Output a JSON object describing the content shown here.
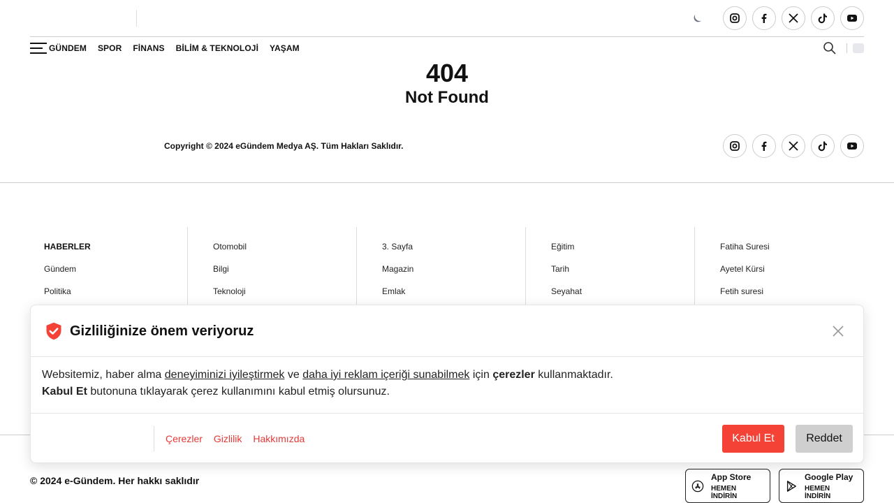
{
  "header": {
    "nav": [
      "GÜNDEM",
      "SPOR",
      "FİNANS",
      "BİLİM & TEKNOLOJİ",
      "YAŞAM"
    ]
  },
  "social": [
    "instagram",
    "facebook",
    "x-twitter",
    "tiktok",
    "youtube"
  ],
  "error": {
    "code": "404",
    "message": "Not Found"
  },
  "footer_top": {
    "copyright": "Copyright © 2024 eGündem Medya AŞ. Tüm Hakları Saklıdır."
  },
  "footer_columns": [
    {
      "heading": "HABERLER",
      "items": [
        "Gündem",
        "Politika"
      ]
    },
    {
      "heading": "",
      "items": [
        "Otomobil",
        "Bilgi",
        "Teknoloji"
      ]
    },
    {
      "heading": "",
      "items": [
        "3. Sayfa",
        "Magazin",
        "Emlak"
      ]
    },
    {
      "heading": "",
      "items": [
        "Eğitim",
        "Tarih",
        "Seyahat"
      ]
    },
    {
      "heading": "",
      "items": [
        "Fatiha Suresi",
        "Ayetel Kürsi",
        "Fetih suresi"
      ]
    }
  ],
  "footer_bottom": {
    "copyright": "© 2024 e-Gündem. Her hakkı saklıdır",
    "app_store": {
      "title": "App Store",
      "subtitle": "HEMEN İNDİRİN"
    },
    "google_play": {
      "title": "Google Play",
      "subtitle": "HEMEN İNDİRİN"
    }
  },
  "cookie": {
    "title": "Gizliliğinize önem veriyoruz",
    "text_1": "Websitemiz, haber alma ",
    "link_1": "deneyiminizi iyileştirmek",
    "text_2": " ve ",
    "link_2": "daha iyi reklam içeriği sunabilmek",
    "text_3": " için ",
    "bold_1": "çerezler",
    "text_4": " kullanmaktadır.",
    "bold_2": "Kabul Et",
    "text_5": " butonuna tıklayarak çerez kullanımını kabul etmiş olursunuz.",
    "links": [
      "Çerezler",
      "Gizlilik",
      "Hakkımızda"
    ],
    "accept": "Kabul Et",
    "reject": "Reddet",
    "accent_color": "#f44336"
  }
}
